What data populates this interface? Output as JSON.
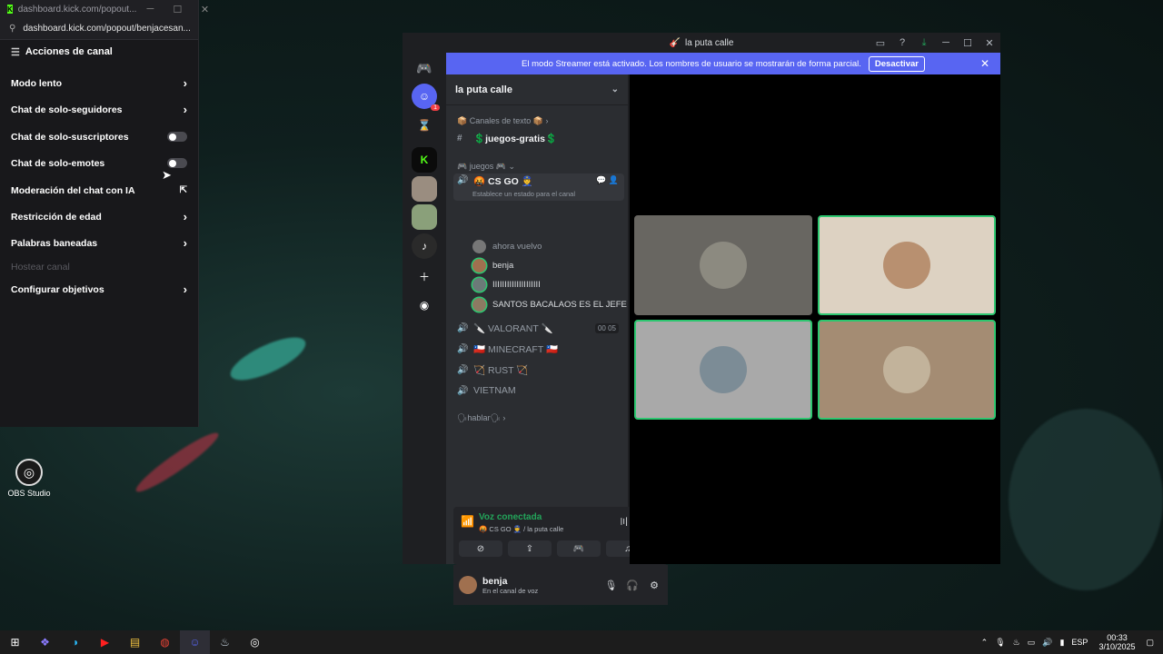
{
  "kick": {
    "tab_title": "dashboard.kick.com/popout...",
    "url": "dashboard.kick.com/popout/benjacesan...",
    "header": "Acciones de canal",
    "items": [
      {
        "label": "Modo lento",
        "control": "chevron"
      },
      {
        "label": "Chat de solo-seguidores",
        "control": "chevron"
      },
      {
        "label": "Chat de solo-suscriptores",
        "control": "toggle",
        "state": "off"
      },
      {
        "label": "Chat de solo-emotes",
        "control": "toggle",
        "state": "off"
      },
      {
        "label": "Moderación del chat con IA",
        "control": "external"
      },
      {
        "label": "Restricción de edad",
        "control": "chevron"
      },
      {
        "label": "Palabras baneadas",
        "control": "chevron"
      },
      {
        "label": "Hostear canal",
        "control": "none",
        "disabled": true
      },
      {
        "label": "Configurar objetivos",
        "control": "chevron"
      }
    ]
  },
  "desktop": {
    "obs_label": "OBS Studio"
  },
  "discord": {
    "window_title": "la puta calle",
    "banner": {
      "text": "El modo Streamer está activado. Los nombres de usuario se mostrarán de forma parcial.",
      "button": "Desactivar"
    },
    "guild_badge": "1",
    "server_name": "la puta calle",
    "category_text": "📦 Canales de texto 📦",
    "text_channel": "💲juegos-gratis💲",
    "category_games": "🎮 juegos 🎮",
    "voice_channels": [
      {
        "name": "🤬 CS GO 👮",
        "status": "Establece un estado para el canal",
        "active": true
      },
      {
        "name": "🔪 VALORANT 🔪",
        "counter": [
          "00",
          "05"
        ]
      },
      {
        "name": "🇨🇱 MINECRAFT 🇨🇱"
      },
      {
        "name": "🏹 RUST 🏹"
      },
      {
        "name": "VIETNAM"
      }
    ],
    "members": [
      "ahora vuelvo",
      "benja",
      "IIIIIIIIIIIIIIIIIIII",
      "SANTOS BACALAOS ES EL JEFE"
    ],
    "category_talk": "🗣hablar🗣",
    "voice_panel": {
      "status": "Voz conectada",
      "location": "🤬 CS GO 👮 / la puta calle"
    },
    "user_panel": {
      "name": "benja",
      "status": "En el canal de voz"
    },
    "colors": {
      "blurple": "#5865f2",
      "connected_green": "#23a55a",
      "speaking_border": "#2dc770"
    }
  },
  "taskbar": {
    "lang": "ESP",
    "time": "00:33",
    "date": "3/10/2025"
  }
}
